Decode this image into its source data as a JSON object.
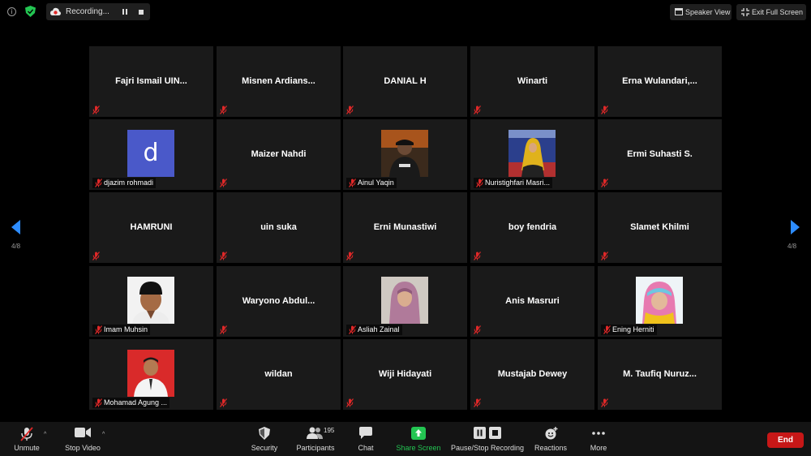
{
  "topbar": {
    "info": "i",
    "recording_label": "Recording...",
    "speaker_view": "Speaker View",
    "exit_fullscreen": "Exit Full Screen"
  },
  "pager": {
    "left": "4/8",
    "right": "4/8"
  },
  "tiles": [
    {
      "name": "Fajri Ismail UIN..."
    },
    {
      "name": "Misnen  Ardians..."
    },
    {
      "name": "DANIAL H"
    },
    {
      "name": "Winarti"
    },
    {
      "name": "Erna  Wulandari,..."
    },
    {
      "label": "djazim rohmadi",
      "avatar": "d"
    },
    {
      "name": "Maizer Nahdi"
    },
    {
      "label": "Ainul Yaqin"
    },
    {
      "label": "Nuristighfari Masri..."
    },
    {
      "name": "Ermi Suhasti S."
    },
    {
      "name": "HAMRUNI"
    },
    {
      "name": "uin suka"
    },
    {
      "name": "Erni Munastiwi"
    },
    {
      "name": "boy fendria"
    },
    {
      "name": "Slamet Khilmi"
    },
    {
      "label": "Imam Muhsin"
    },
    {
      "name": "Waryono  Abdul..."
    },
    {
      "label": "Asliah Zainal"
    },
    {
      "name": "Anis Masruri"
    },
    {
      "label": "Ening Herniti"
    },
    {
      "label": "Mohamad Agung ..."
    },
    {
      "name": "wildan"
    },
    {
      "name": "Wiji Hidayati"
    },
    {
      "name": "Mustajab Dewey"
    },
    {
      "name": "M.  Taufiq Nuruz..."
    }
  ],
  "toolbar": {
    "unmute": "Unmute",
    "stop_video": "Stop Video",
    "security": "Security",
    "participants": "Participants",
    "participants_count": "195",
    "chat": "Chat",
    "share_screen": "Share Screen",
    "pause_stop_recording": "Pause/Stop Recording",
    "reactions": "Reactions",
    "more": "More",
    "end": "End"
  },
  "colors": {
    "background": "#000000",
    "tile": "#1a1a1a",
    "share_green": "#23c552",
    "end_red": "#c71717",
    "mic_muted_red": "#e02828",
    "avatar_blue": "#4a59c9"
  }
}
